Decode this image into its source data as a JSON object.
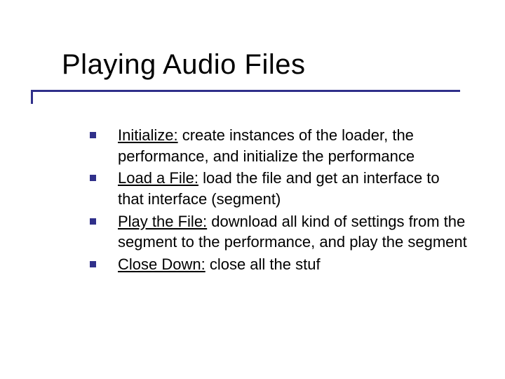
{
  "title": "Playing Audio Files",
  "items": [
    {
      "lead": "Initialize:",
      "rest": " create instances of the loader, the performance, and initialize the performance"
    },
    {
      "lead": "Load a File:",
      "rest": " load the file and get an interface to that interface (segment)"
    },
    {
      "lead": "Play the File:",
      "rest": " download all kind of settings from the segment to the performance, and play the segment"
    },
    {
      "lead": "Close Down:",
      "rest": " close all the stuf"
    }
  ]
}
